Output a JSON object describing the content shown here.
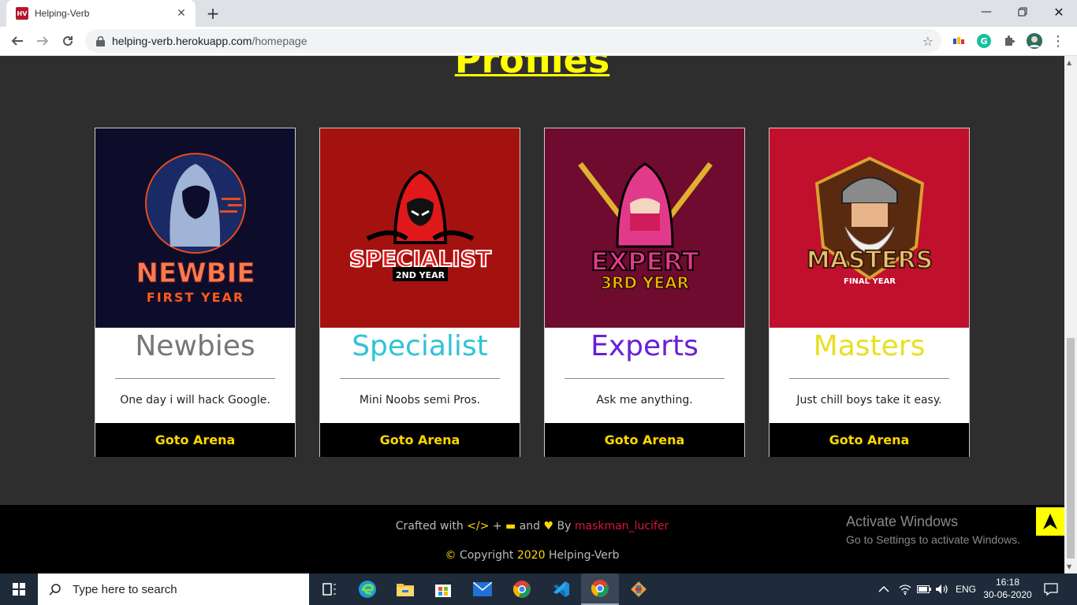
{
  "browser": {
    "tab_title": "Helping-Verb",
    "favicon_text": "HV",
    "url_host": "helping-verb.herokuapp.com",
    "url_path": "/homepage"
  },
  "page": {
    "section_title": "Profiles",
    "cards": [
      {
        "name": "Newbies",
        "name_color": "#777777",
        "badge_main": "NEWBIE",
        "badge_sub": "FIRST YEAR",
        "description": "One day i will hack Google.",
        "button": "Goto Arena",
        "bg": "#0d0d2b"
      },
      {
        "name": "Specialist",
        "name_color": "#2ec4d6",
        "badge_main": "SPECIALIST",
        "badge_sub": "2ND YEAR",
        "description": "Mini Noobs semi Pros.",
        "button": "Goto Arena",
        "bg": "#a4120f"
      },
      {
        "name": "Experts",
        "name_color": "#6a1fd6",
        "badge_main": "EXPERT",
        "badge_sub": "3RD YEAR",
        "description": "Ask me anything.",
        "button": "Goto Arena",
        "bg": "#6e0b2e"
      },
      {
        "name": "Masters",
        "name_color": "#e8e020",
        "badge_main": "MASTERS",
        "badge_sub": "FINAL YEAR",
        "description": "Just chill boys take it easy.",
        "button": "Goto Arena",
        "bg": "#c0102d"
      }
    ]
  },
  "footer": {
    "crafted_prefix": "Crafted with",
    "crafted_and": "and",
    "crafted_by": "By",
    "author": "maskman_lucifer",
    "copyright_word": "Copyright",
    "year": "2020",
    "site_name": "Helping-Verb",
    "activate_title": "Activate Windows",
    "activate_sub": "Go to Settings to activate Windows."
  },
  "taskbar": {
    "search_placeholder": "Type here to search",
    "language": "ENG",
    "time": "16:18",
    "date": "30-06-2020"
  }
}
